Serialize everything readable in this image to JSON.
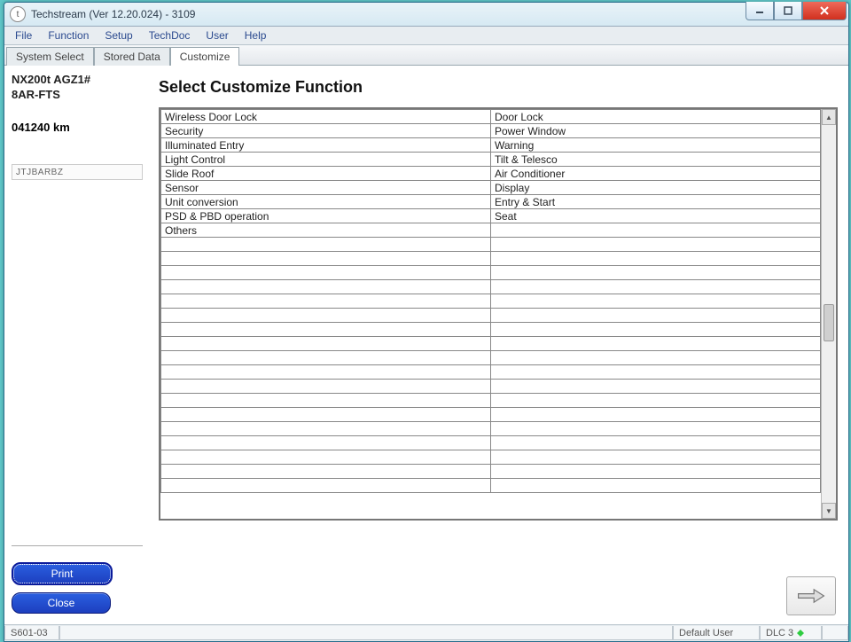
{
  "window": {
    "title": "Techstream (Ver 12.20.024) - 3109"
  },
  "menu": {
    "items": [
      "File",
      "Function",
      "Setup",
      "TechDoc",
      "User",
      "Help"
    ]
  },
  "tabs": {
    "items": [
      "System Select",
      "Stored Data",
      "Customize"
    ],
    "active_index": 2
  },
  "vehicle": {
    "line1": "NX200t AGZ1#",
    "line2": "8AR-FTS",
    "odometer": "041240 km",
    "vin": "JTJBARBZ"
  },
  "buttons": {
    "print": "Print",
    "close": "Close"
  },
  "page": {
    "heading": "Select Customize Function"
  },
  "grid": {
    "rows": [
      {
        "c1": "Wireless Door Lock",
        "c2": "Door Lock"
      },
      {
        "c1": "Security",
        "c2": "Power Window"
      },
      {
        "c1": "Illuminated Entry",
        "c2": "Warning"
      },
      {
        "c1": "Light Control",
        "c2": "Tilt & Telesco"
      },
      {
        "c1": "Slide Roof",
        "c2": "Air Conditioner"
      },
      {
        "c1": "Sensor",
        "c2": "Display"
      },
      {
        "c1": "Unit conversion",
        "c2": "Entry & Start"
      },
      {
        "c1": "PSD & PBD operation",
        "c2": "Seat"
      },
      {
        "c1": "Others",
        "c2": ""
      }
    ],
    "blank_rows": 18
  },
  "status": {
    "left": "S601-03",
    "user": "Default User",
    "dlc": "DLC 3"
  }
}
